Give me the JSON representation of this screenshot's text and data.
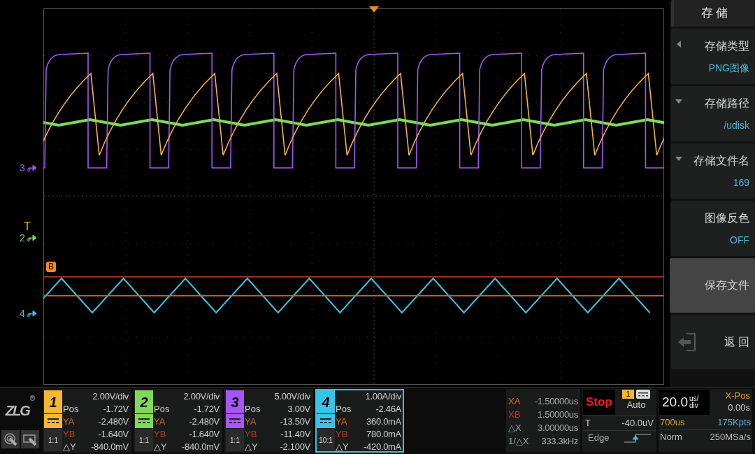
{
  "plot": {
    "markers": [
      {
        "label": "3",
        "color": "#a855f7"
      },
      {
        "label": "2",
        "color": "#7ed957"
      },
      {
        "label": "4",
        "color": "#36c5e8"
      }
    ],
    "trigger_label": "T",
    "cursor_label": "B"
  },
  "menu": {
    "title": "存 储",
    "items": [
      {
        "kind": "cycle",
        "label": "存储类型",
        "value": "PNG图像"
      },
      {
        "kind": "dropdown",
        "label": "存储路径",
        "value": "/udisk"
      },
      {
        "kind": "dropdown",
        "label": "存储文件名",
        "value": "169"
      },
      {
        "kind": "toggle",
        "label": "图像反色",
        "value": "OFF"
      },
      {
        "kind": "button",
        "label": "保存文件"
      },
      {
        "kind": "back",
        "label": "返 回"
      }
    ]
  },
  "logo": {
    "text": "ZLG",
    "mark": "®"
  },
  "channels": [
    {
      "number": "1",
      "color": "#f7b731",
      "selected": false,
      "scale": "2.00V/div",
      "pos_label": "Pos",
      "pos": "-1.72V",
      "ya_label": "YA",
      "ya": "-2.480V",
      "yb_label": "YB",
      "yb": "-1.640V",
      "dy_label": "△Y",
      "dy": "-840.0mV",
      "probe": "1:1"
    },
    {
      "number": "2",
      "color": "#7ed957",
      "selected": false,
      "scale": "2.00V/div",
      "pos_label": "Pos",
      "pos": "-1.72V",
      "ya_label": "YA",
      "ya": "-2.480V",
      "yb_label": "YB",
      "yb": "-1.640V",
      "dy_label": "△Y",
      "dy": "-840.0mV",
      "probe": "1:1"
    },
    {
      "number": "3",
      "color": "#a855f7",
      "selected": false,
      "scale": "5.00V/div",
      "pos_label": "Pos",
      "pos": "3.00V",
      "ya_label": "YA",
      "ya": "-13.50V",
      "yb_label": "YB",
      "yb": "-11.40V",
      "dy_label": "△Y",
      "dy": "-2.100V",
      "probe": "1:1"
    },
    {
      "number": "4",
      "color": "#36c5e8",
      "selected": true,
      "scale": "1.00A/div",
      "pos_label": "Pos",
      "pos": "-2.46A",
      "ya_label": "YA",
      "ya": "360.0mA",
      "yb_label": "YB",
      "yb": "780.0mA",
      "dy_label": "△Y",
      "dy": "-420.0mA",
      "probe": "10:1"
    }
  ],
  "cursors": [
    {
      "label": "XA",
      "value": "-1.50000us",
      "color": "#d9651e"
    },
    {
      "label": "XB",
      "value": "1.50000us",
      "color": "#c2361d"
    },
    {
      "label": "△X",
      "value": "3.00000us",
      "color": "#9ca3af"
    },
    {
      "label": "1/△X",
      "value": "333.3kHz",
      "color": "#9ca3af"
    }
  ],
  "trigger": {
    "state": "Stop",
    "source": "1",
    "mode": "Auto",
    "level_label": "T",
    "level": "-40.0uV",
    "type": "Edge"
  },
  "timebase": {
    "scale": "20.0",
    "unit_top": "us/",
    "unit_bottom": "div",
    "xpos_label": "X-Pos",
    "xpos": "0.00s",
    "window": "700us",
    "points": "175Kpts",
    "acq": "Norm",
    "rate": "250MSa/s"
  }
}
